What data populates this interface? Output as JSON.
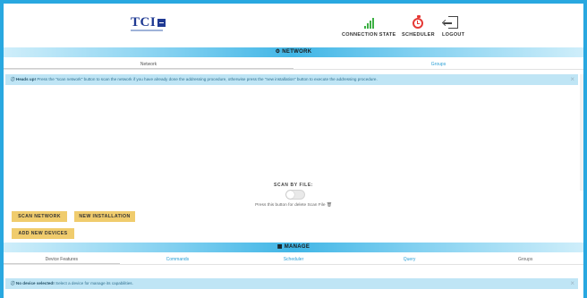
{
  "header": {
    "logo_text": "TCI",
    "connection_state": "CONNECTION STATE",
    "scheduler": "SCHEDULER",
    "logout": "LOGOUT"
  },
  "network": {
    "title": "⚙ NETWORK",
    "tabs": [
      "Network",
      "Groups"
    ],
    "alert_bold": "ⓘ Heads up!",
    "alert_text": " Press the \"scan network\" button to scan the network if you have already done the addressing procedure, otherwise press the \"new installation\" button to execute the addressing procedure.",
    "close": "×",
    "scan_file_label": "SCAN BY FILE:",
    "scan_file_hint": "Press this button for delete Scan File 🗑",
    "buttons": {
      "scan_network": "SCAN NETWORK",
      "new_installation": "NEW INSTALLATION",
      "add_new_devices": "ADD NEW DEVICES"
    }
  },
  "manage": {
    "title": "▦ MANAGE",
    "tabs": [
      "Device Features",
      "Commands",
      "Scheduler",
      "Query",
      "Groups"
    ],
    "alert_bold": "ⓘ No device selected!",
    "alert_text": " Select a device for manage its capabilities.",
    "close": "×"
  },
  "colors": {
    "accent": "#29a8e0",
    "button": "#f0cc6d",
    "alert_bg": "#bfe5f5",
    "link": "#2a9fd6"
  },
  "icons": {
    "connection": "signal-bars-icon",
    "scheduler": "alarm-clock-icon",
    "logout": "logout-icon"
  }
}
